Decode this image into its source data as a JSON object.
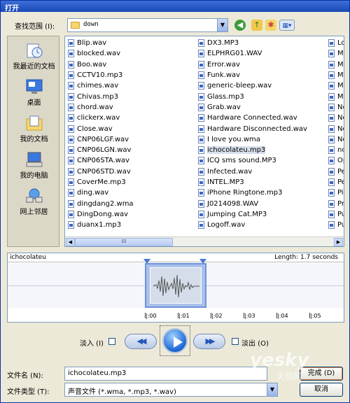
{
  "window": {
    "title": "打开"
  },
  "lookin": {
    "label": "查找范围 (I):",
    "value": "down"
  },
  "places": [
    {
      "label": "我最近的文档",
      "icon": "recent-documents-icon"
    },
    {
      "label": "桌面",
      "icon": "desktop-icon"
    },
    {
      "label": "我的文档",
      "icon": "my-documents-icon"
    },
    {
      "label": "我的电脑",
      "icon": "my-computer-icon"
    },
    {
      "label": "网上邻居",
      "icon": "network-places-icon"
    }
  ],
  "files": {
    "col1": [
      "Blip.wav",
      "blocked.wav",
      "Boo.wav",
      "CCTV10.mp3",
      "chimes.wav",
      "Chivas.mp3",
      "chord.wav",
      "clickerx.wav",
      "Close.wav",
      "CNP06LGF.wav",
      "CNP06LGN.wav",
      "CNP06STA.wav",
      "CNP06STD.wav",
      "CoverMe.mp3",
      "ding.wav",
      "dingdang2.wma",
      "DingDong.wav",
      "duanx1.mp3"
    ],
    "col2": [
      "DX3.MP3",
      "ELPHRG01.WAV",
      "Error.wav",
      "Funk.wav",
      "generic-bleep.wav",
      "Glass.mp3",
      "Grab.wav",
      "Hardware Connected.wav",
      "Hardware Disconnected.wav",
      "I love you.wma",
      "ichocolateu.mp3",
      "ICQ sms sound.MP3",
      "Infected.wav",
      "INTEL.MP3",
      "iPhone Ringtone.mp3",
      "J0214098.WAV",
      "Jumping Cat.MP3",
      "Logoff.wav"
    ],
    "col3": [
      "Lo",
      "M",
      "M",
      "M",
      "M",
      "M",
      "Ne",
      "Ne",
      "No",
      "No",
      "no",
      "Op",
      "Pe",
      "Pe",
      "Pi",
      "Pr",
      "Pu",
      "Pu"
    ],
    "selected": "ichocolateu.mp3"
  },
  "preview": {
    "name": "ichocolateu",
    "length": "Length: 1.7 seconds",
    "ticks": [
      "|:00",
      "|:01",
      "|:02",
      "|:03",
      "|:04",
      "|:05"
    ]
  },
  "controls": {
    "fade_in": "淡入 (I)",
    "fade_out": "淡出 (O)",
    "rewind": "◀◀",
    "forward": "▶▶"
  },
  "filename": {
    "label": "文件名 (N):",
    "value": "ichocolateu.mp3"
  },
  "filetype": {
    "label": "文件类型 (T):",
    "value": "声音文件 (*.wma, *.mp3, *.wav)"
  },
  "buttons": {
    "ok": "完成 (D)",
    "cancel": "取消"
  },
  "watermark": {
    "brand": "yesky",
    "sub": "天极网"
  }
}
